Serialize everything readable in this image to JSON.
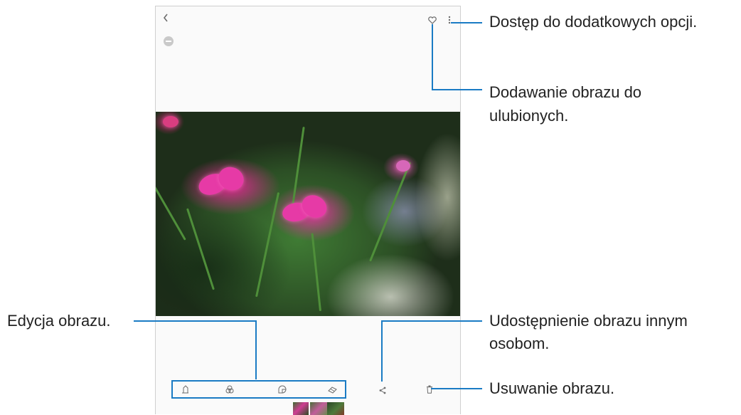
{
  "device": {
    "back_icon": "chevron-left-icon",
    "info_icon": "info-circle-icon",
    "favorite_icon": "heart-outline-icon",
    "more_icon": "more-vertical-icon",
    "share_icon": "share-icon",
    "delete_icon": "trash-icon"
  },
  "edit_toolbar": {
    "icons": [
      "pencil-edit-icon",
      "filters-icon",
      "sticker-icon",
      "eraser-icon"
    ]
  },
  "thumbnails": {
    "count": 3
  },
  "callouts": {
    "more_options": "Dostęp do dodatkowych opcji.",
    "favorite_line1": "Dodawanie obrazu do",
    "favorite_line2": "ulubionych.",
    "edit": "Edycja obrazu.",
    "share_line1": "Udostępnienie obrazu innym",
    "share_line2": "osobom.",
    "delete": "Usuwanie obrazu."
  },
  "colors": {
    "accent": "#1a7bc4",
    "text": "#222222",
    "icon": "#6c6c6c"
  }
}
